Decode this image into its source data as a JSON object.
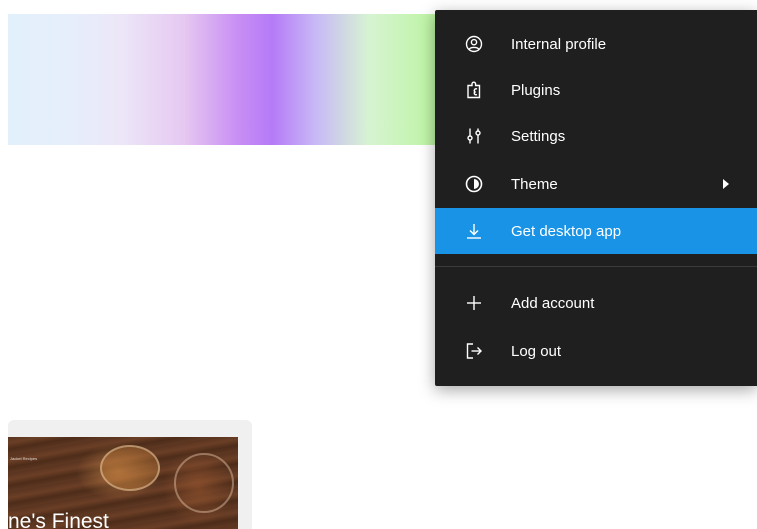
{
  "menu": {
    "items": [
      {
        "label": "Internal profile",
        "icon": "user-circle-icon"
      },
      {
        "label": "Plugins",
        "icon": "puzzle-icon"
      },
      {
        "label": "Settings",
        "icon": "sliders-icon"
      },
      {
        "label": "Theme",
        "icon": "theme-icon",
        "has_submenu": true
      },
      {
        "label": "Get desktop app",
        "icon": "download-icon",
        "highlighted": true
      },
      {
        "label": "Add account",
        "icon": "plus-icon"
      },
      {
        "label": "Log out",
        "icon": "logout-icon"
      }
    ]
  },
  "card": {
    "title": "ne's Finest",
    "nav_text": "Jacket Recipes"
  },
  "colors": {
    "menu_bg": "#1f1f1f",
    "highlight": "#1893e6",
    "divider": "#3b3b3b"
  }
}
